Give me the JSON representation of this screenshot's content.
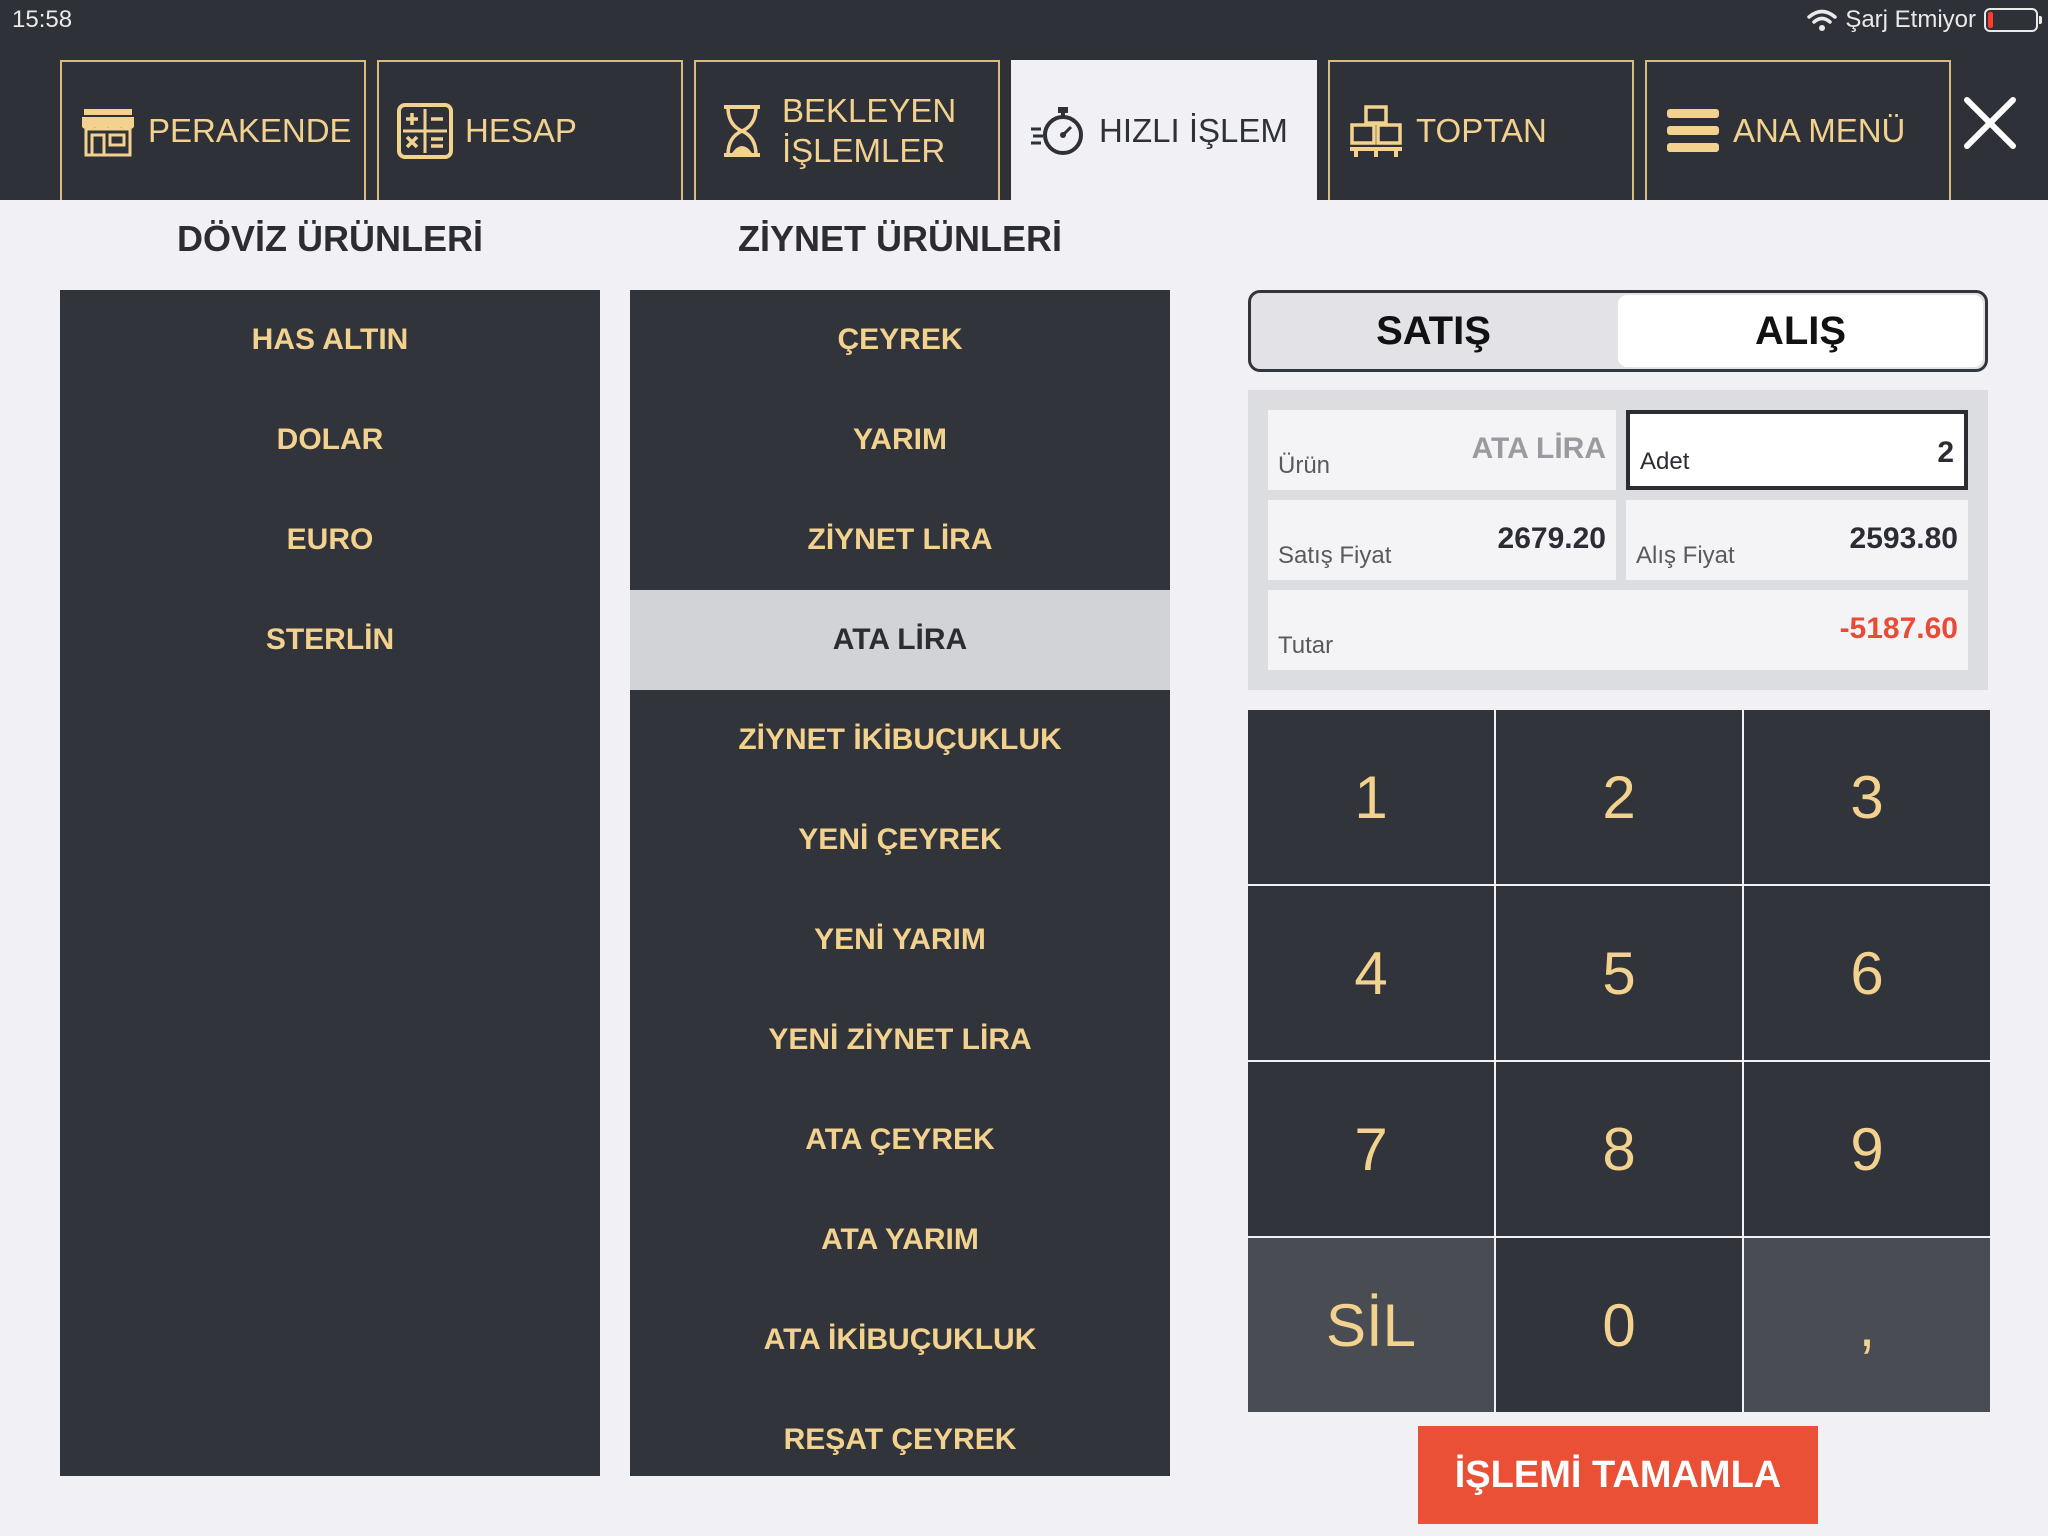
{
  "status_bar": {
    "time": "15:58",
    "charging_text": "Şarj Etmiyor"
  },
  "nav": {
    "tabs": [
      {
        "label": "PERAKENDE",
        "icon": "store-icon",
        "active": false
      },
      {
        "label": "HESAP",
        "icon": "calculator-icon",
        "active": false
      },
      {
        "label_line1": "BEKLEYEN",
        "label_line2": "İŞLEMLER",
        "icon": "hourglass-icon",
        "active": false
      },
      {
        "label": "HIZLI İŞLEM",
        "icon": "stopwatch-icon",
        "active": true
      },
      {
        "label": "TOPTAN",
        "icon": "boxes-icon",
        "active": false
      },
      {
        "label": "ANA MENÜ",
        "icon": "menu-icon",
        "active": false
      }
    ],
    "close_icon": "close-icon"
  },
  "doviz": {
    "heading": "DÖVİZ ÜRÜNLERİ",
    "items": [
      "HAS ALTIN",
      "DOLAR",
      "EURO",
      "STERLİN"
    ]
  },
  "ziynet": {
    "heading": "ZİYNET ÜRÜNLERİ",
    "items": [
      "ÇEYREK",
      "YARIM",
      "ZİYNET LİRA",
      "ATA LİRA",
      "ZİYNET İKİBUÇUKLUK",
      "YENİ ÇEYREK",
      "YENİ YARIM",
      "YENİ ZİYNET LİRA",
      "ATA ÇEYREK",
      "ATA YARIM",
      "ATA İKİBUÇUKLUK",
      "REŞAT ÇEYREK"
    ],
    "selected_index": 3
  },
  "mode": {
    "sell_label": "SATIŞ",
    "buy_label": "ALIŞ",
    "active": "buy"
  },
  "transaction": {
    "product_label": "Ürün",
    "product_value": "ATA LİRA",
    "quantity_label": "Adet",
    "quantity_value": "2",
    "sell_price_label": "Satış Fiyat",
    "sell_price_value": "2679.20",
    "buy_price_label": "Alış Fiyat",
    "buy_price_value": "2593.80",
    "total_label": "Tutar",
    "total_value": "-5187.60"
  },
  "keypad": {
    "keys": [
      "1",
      "2",
      "3",
      "4",
      "5",
      "6",
      "7",
      "8",
      "9",
      "SİL",
      "0",
      ","
    ]
  },
  "actions": {
    "complete_label": "İŞLEMİ TAMAMLA"
  },
  "colors": {
    "dark": "#2f3138",
    "gold": "#f2d28e",
    "accent_red": "#ea5035",
    "background": "#f1f1f5"
  }
}
